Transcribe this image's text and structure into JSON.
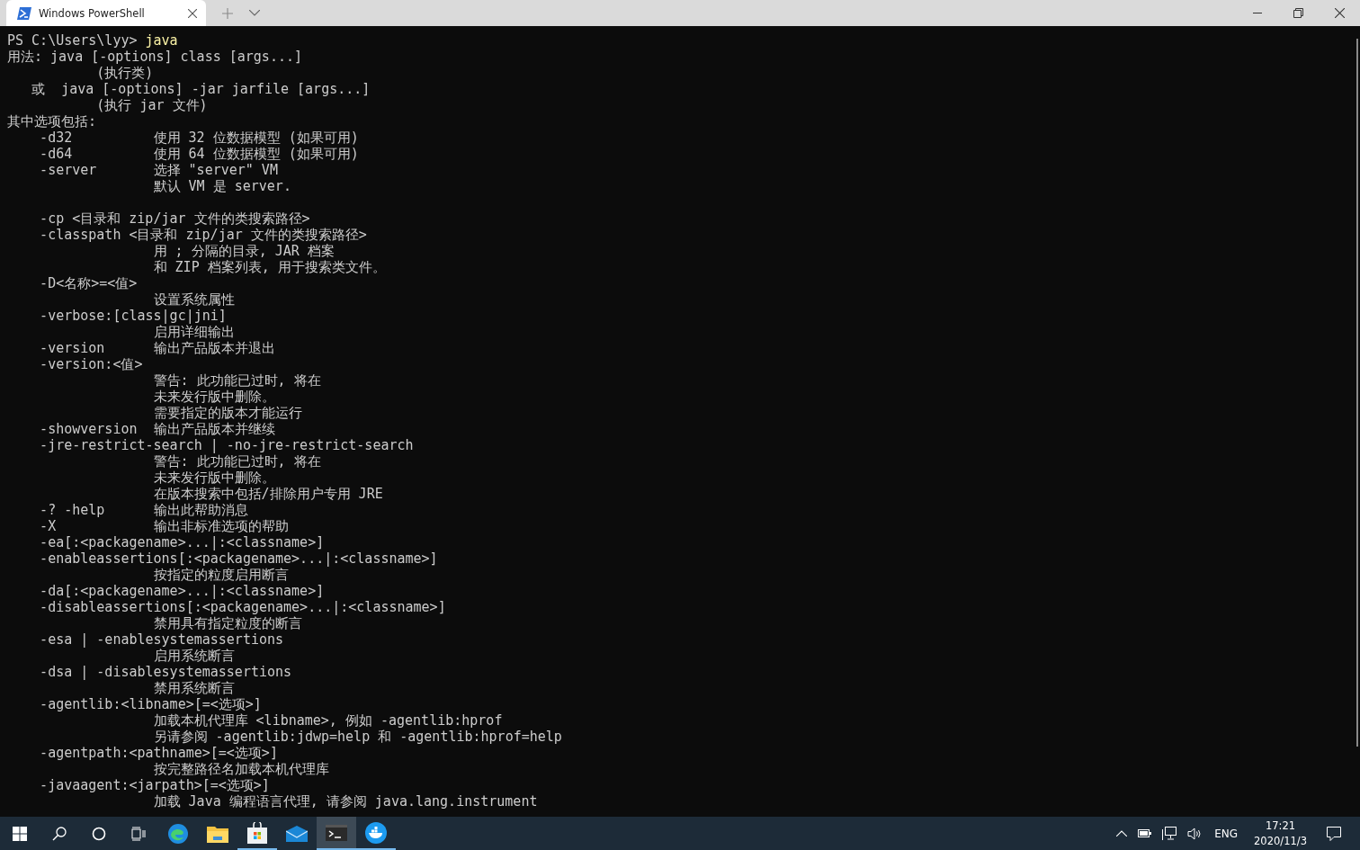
{
  "tabs": [
    {
      "title": "Windows PowerShell",
      "selected": true
    }
  ],
  "terminal": {
    "prompt": "PS C:\\Users\\lyy> ",
    "command": "java",
    "output": [
      [
        "用法: java [-options] class [args...]",
        "           (执行类)",
        "   或  java [-options] -jar jarfile [args...]",
        "           (执行 jar 文件)",
        "其中选项包括:",
        "    -d32          使用 32 位数据模型 (如果可用)",
        "    -d64          使用 64 位数据模型 (如果可用)",
        "    -server       选择 \"server\" VM",
        "                  默认 VM 是 server."
      ],
      [
        "    -cp <目录和 zip/jar 文件的类搜索路径>",
        "    -classpath <目录和 zip/jar 文件的类搜索路径>",
        "                  用 ; 分隔的目录, JAR 档案",
        "                  和 ZIP 档案列表, 用于搜索类文件。",
        "    -D<名称>=<值>",
        "                  设置系统属性",
        "    -verbose:[class|gc|jni]",
        "                  启用详细输出",
        "    -version      输出产品版本并退出",
        "    -version:<值>",
        "                  警告: 此功能已过时, 将在",
        "                  未来发行版中删除。",
        "                  需要指定的版本才能运行",
        "    -showversion  输出产品版本并继续",
        "    -jre-restrict-search | -no-jre-restrict-search",
        "                  警告: 此功能已过时, 将在",
        "                  未来发行版中删除。",
        "                  在版本搜索中包括/排除用户专用 JRE",
        "    -? -help      输出此帮助消息",
        "    -X            输出非标准选项的帮助",
        "    -ea[:<packagename>...|:<classname>]",
        "    -enableassertions[:<packagename>...|:<classname>]",
        "                  按指定的粒度启用断言",
        "    -da[:<packagename>...|:<classname>]",
        "    -disableassertions[:<packagename>...|:<classname>]",
        "                  禁用具有指定粒度的断言",
        "    -esa | -enablesystemassertions",
        "                  启用系统断言",
        "    -dsa | -disablesystemassertions",
        "                  禁用系统断言",
        "    -agentlib:<libname>[=<选项>]",
        "                  加载本机代理库 <libname>, 例如 -agentlib:hprof",
        "                  另请参阅 -agentlib:jdwp=help 和 -agentlib:hprof=help",
        "    -agentpath:<pathname>[=<选项>]",
        "                  按完整路径名加载本机代理库",
        "    -javaagent:<jarpath>[=<选项>]",
        "                  加载 Java 编程语言代理, 请参阅 java.lang.instrument"
      ]
    ]
  },
  "taskbar": {
    "apps": [
      {
        "kind": "edge",
        "running": false,
        "selected": false
      },
      {
        "kind": "explorer",
        "running": false,
        "selected": false
      },
      {
        "kind": "store",
        "running": true,
        "selected": false
      },
      {
        "kind": "mail",
        "running": false,
        "selected": false
      },
      {
        "kind": "terminal",
        "running": true,
        "selected": true
      },
      {
        "kind": "whale",
        "running": true,
        "selected": false
      }
    ],
    "language": "ENG",
    "time": "17:21",
    "date": "2020/11/3"
  }
}
